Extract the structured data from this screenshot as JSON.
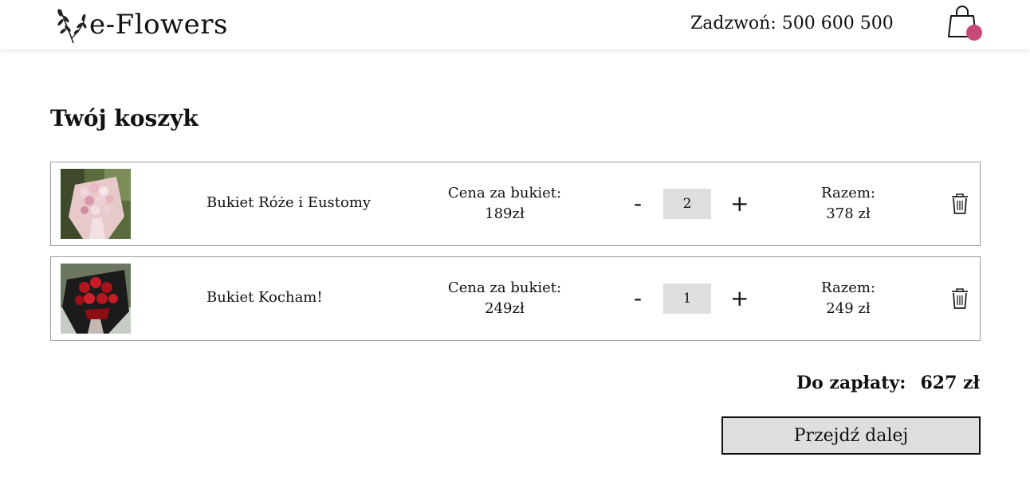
{
  "header": {
    "logo_text": "e-Flowers",
    "phone_text": "Zadzwoń: 500 600 500",
    "cart_dot_color": "#c9487a"
  },
  "page_title": "Twój koszyk",
  "cart": {
    "items": [
      {
        "name": "Bukiet Róże i Eustomy",
        "price_label": "Cena za bukiet:",
        "price": "189zł",
        "quantity": "2",
        "minus_label": "-",
        "plus_label": "+",
        "total_label": "Razem:",
        "total": "378 zł"
      },
      {
        "name": "Bukiet Kocham!",
        "price_label": "Cena za bukiet:",
        "price": "249zł",
        "quantity": "1",
        "minus_label": "-",
        "plus_label": "+",
        "total_label": "Razem:",
        "total": "249 zł"
      }
    ]
  },
  "summary": {
    "label": "Do zapłaty:",
    "value": "627 zł"
  },
  "next_button": "Przejdź dalej"
}
